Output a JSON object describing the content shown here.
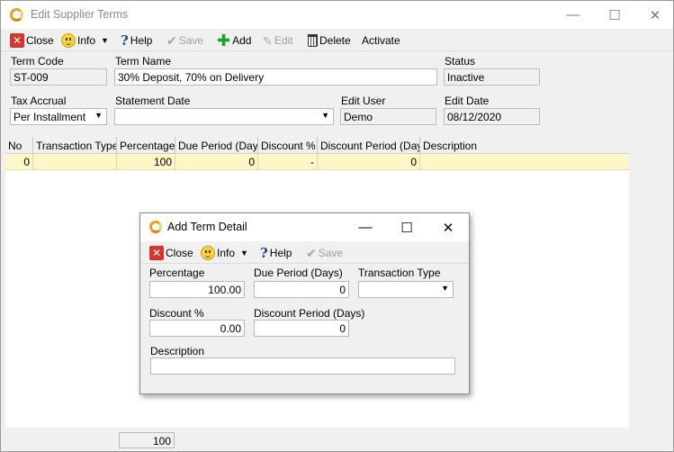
{
  "window": {
    "title": "Edit Supplier Terms",
    "minimize_glyph": "—",
    "maximize_glyph": "☐",
    "close_glyph": "✕"
  },
  "toolbar": {
    "close": "Close",
    "info": "Info",
    "help": "Help",
    "save": "Save",
    "add": "Add",
    "edit": "Edit",
    "delete": "Delete",
    "activate": "Activate"
  },
  "form": {
    "term_code_label": "Term Code",
    "term_code_value": "ST-009",
    "term_name_label": "Term Name",
    "term_name_value": "30% Deposit, 70% on Delivery",
    "status_label": "Status",
    "status_value": "Inactive",
    "tax_accrual_label": "Tax Accrual",
    "tax_accrual_value": "Per Installment",
    "statement_date_label": "Statement Date",
    "statement_date_value": "",
    "edit_user_label": "Edit User",
    "edit_user_value": "Demo",
    "edit_date_label": "Edit Date",
    "edit_date_value": "08/12/2020"
  },
  "grid": {
    "columns": [
      "No",
      "Transaction Type",
      "Percentage",
      "Due Period (Days)",
      "Discount %",
      "Discount Period (Days)",
      "Description"
    ],
    "rows": [
      {
        "no": "0",
        "transaction_type": "",
        "percentage": "100",
        "due_period": "0",
        "discount": "-",
        "discount_period": "0",
        "description": ""
      }
    ],
    "footer_total": "100"
  },
  "dialog": {
    "title": "Add Term Detail",
    "toolbar": {
      "close": "Close",
      "info": "Info",
      "help": "Help",
      "save": "Save"
    },
    "percentage_label": "Percentage",
    "percentage_value": "100.00",
    "due_period_label": "Due Period (Days)",
    "due_period_value": "0",
    "transaction_type_label": "Transaction Type",
    "transaction_type_value": "",
    "discount_label": "Discount %",
    "discount_value": "0.00",
    "discount_period_label": "Discount Period (Days)",
    "discount_period_value": "0",
    "description_label": "Description",
    "description_value": ""
  },
  "icons": {
    "close": "close-icon",
    "info": "info-smiley-icon",
    "help": "help-question-icon",
    "save": "save-check-icon",
    "add": "add-plus-icon",
    "edit": "edit-pencil-icon",
    "delete": "delete-trash-icon",
    "dropdown": "chevron-down-icon"
  },
  "colors": {
    "selected_row": "#fdf7c8",
    "close_icon": "#d9342b",
    "add_icon": "#1a9e2c",
    "help_icon": "#1d3fa8"
  }
}
